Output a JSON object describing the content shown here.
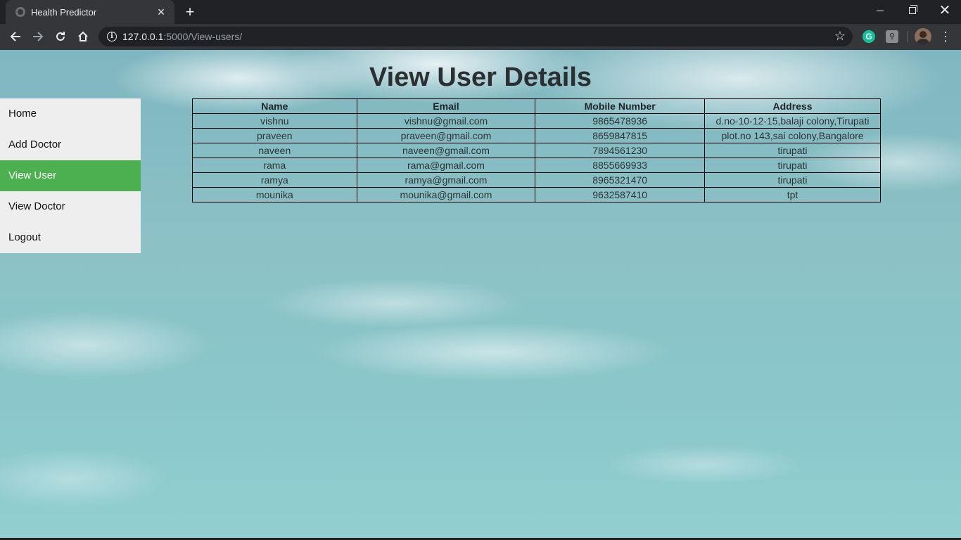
{
  "browser": {
    "tab_title": "Health Predictor",
    "url_host": "127.0.0.1",
    "url_path": ":5000/View-users/",
    "icons": {
      "back": "arrow-left-icon",
      "forward": "arrow-right-icon",
      "reload": "reload-icon",
      "home": "home-icon",
      "info": "info-icon",
      "bookmark": "star-icon",
      "grammarly": "grammarly-icon",
      "extension": "bulb-icon",
      "menu": "kebab-menu-icon"
    }
  },
  "page": {
    "title": "View User Details",
    "accent_color": "#4caf50"
  },
  "sidebar": {
    "items": [
      {
        "label": "Home",
        "active": false
      },
      {
        "label": "Add Doctor",
        "active": false
      },
      {
        "label": "View User",
        "active": true
      },
      {
        "label": "View Doctor",
        "active": false
      },
      {
        "label": "Logout",
        "active": false
      }
    ]
  },
  "users_table": {
    "headers": [
      "Name",
      "Email",
      "Mobile Number",
      "Address"
    ],
    "rows": [
      [
        "vishnu",
        "vishnu@gmail.com",
        "9865478936",
        "d.no-10-12-15,balaji colony,Tirupati"
      ],
      [
        "praveen",
        "praveen@gmail.com",
        "8659847815",
        "plot.no 143,sai colony,Bangalore"
      ],
      [
        "naveen",
        "naveen@gmail.com",
        "7894561230",
        "tirupati"
      ],
      [
        "rama",
        "rama@gmail.com",
        "8855669933",
        "tirupati"
      ],
      [
        "ramya",
        "ramya@gmail.com",
        "8965321470",
        "tirupati"
      ],
      [
        "mounika",
        "mounika@gmail.com",
        "9632587410",
        "tpt"
      ]
    ]
  }
}
